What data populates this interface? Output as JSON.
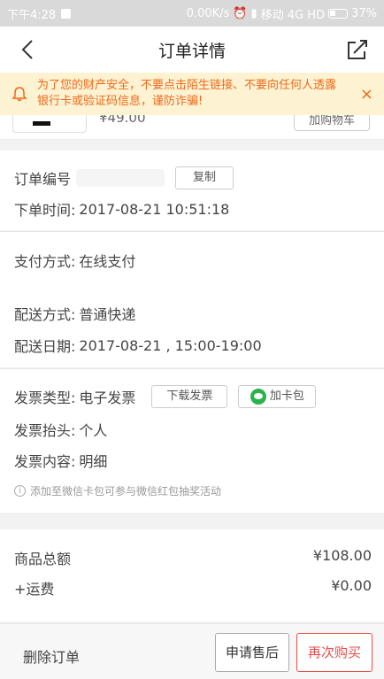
{
  "status_bar": {
    "time": "下午4:28",
    "network_speed": "0.00K/s",
    "carrier": "移动 4G HD",
    "battery": "37%"
  },
  "nav": {
    "title": "订单详情"
  },
  "notice": {
    "text": "为了您的财产安全，不要点击陌生链接、不要向任何人透露银行卡或验证码信息，谨防诈骗!",
    "close": "×"
  },
  "goods": {
    "price": "¥49.00",
    "button": "加购物车"
  },
  "order": {
    "number_label": "订单编号",
    "copy_button": "复制",
    "time_label": "下单时间:",
    "time_value": "2017-08-21 10:51:18"
  },
  "delivery": {
    "pay_label": "支付方式:",
    "pay_value": "在线支付",
    "ship_label": "配送方式:",
    "ship_value": "普通快递",
    "date_label": "配送日期:",
    "date_value": "2017-08-21 , 15:00-19:00"
  },
  "invoice": {
    "type_label": "发票类型:",
    "type_value": "电子发票",
    "download_button": "下载发票",
    "card_button": "加卡包",
    "title_label": "发票抬头:",
    "title_value": "个人",
    "content_label": "发票内容:",
    "content_value": "明细",
    "tip": "添加至微信卡包可参与微信红包抽奖活动"
  },
  "summary": {
    "total_label": "商品总额",
    "total_value": "¥108.00",
    "shipping_label": "+运费",
    "shipping_value": "¥0.00"
  },
  "actions": {
    "delete": "删除订单",
    "after_sale": "申请售后",
    "rebuy": "再次购买"
  },
  "colors": {
    "accent_orange": "#f06a1a",
    "notice_bg": "#fdf2d2",
    "rebuy_red": "#e94b4b",
    "wechat_green": "#2bb24c"
  }
}
